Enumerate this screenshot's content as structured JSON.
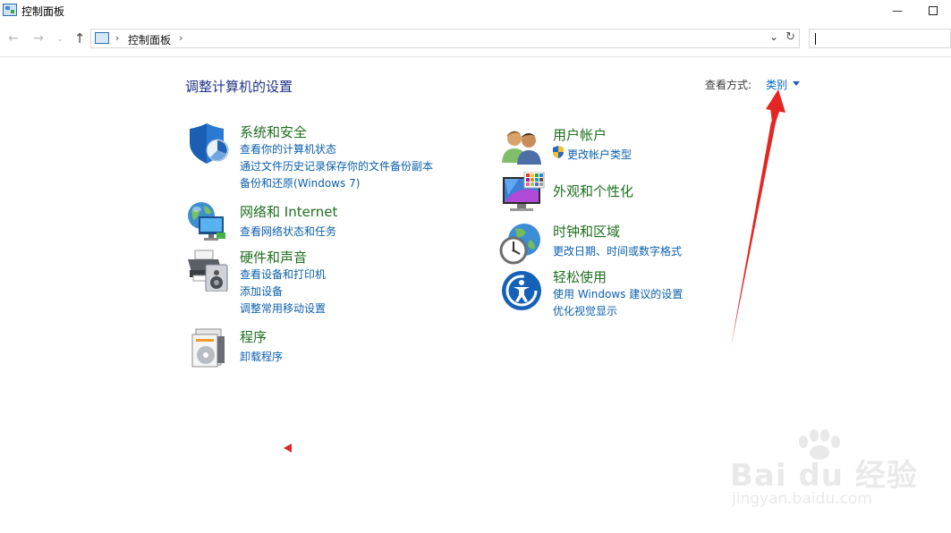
{
  "window": {
    "title": "控制面板",
    "minimize_glyph": "—"
  },
  "navigation": {
    "back_glyph": "←",
    "forward_glyph": "→",
    "recent_glyph": "⌄",
    "up_glyph": "↑",
    "breadcrumb_sep": "›",
    "breadcrumb": "控制面板",
    "dropdown_glyph": "⌄",
    "refresh_glyph": "↻",
    "search_placeholder": ""
  },
  "main": {
    "title": "调整计算机的设置",
    "view_by_label": "查看方式:",
    "view_by_value": "类别"
  },
  "categories_left": [
    {
      "title": "系统和安全",
      "icon": "shield-icon",
      "links": [
        "查看你的计算机状态",
        "通过文件历史记录保存你的文件备份副本",
        "备份和还原(Windows 7)"
      ]
    },
    {
      "title": "网络和 Internet",
      "icon": "network-globe-icon",
      "links": [
        "查看网络状态和任务"
      ]
    },
    {
      "title": "硬件和声音",
      "icon": "printer-speaker-icon",
      "links": [
        "查看设备和打印机",
        "添加设备",
        "调整常用移动设置"
      ]
    },
    {
      "title": "程序",
      "icon": "programs-disc-icon",
      "links": [
        "卸载程序"
      ]
    }
  ],
  "categories_right": [
    {
      "title": "用户帐户",
      "icon": "users-icon",
      "links": [
        "更改帐户类型"
      ]
    },
    {
      "title": "外观和个性化",
      "icon": "monitor-palette-icon",
      "links": []
    },
    {
      "title": "时钟和区域",
      "icon": "clock-globe-icon",
      "links": [
        "更改日期、时间或数字格式"
      ]
    },
    {
      "title": "轻松使用",
      "icon": "ease-of-access-icon",
      "links": [
        "使用 Windows 建议的设置",
        "优化视觉显示"
      ]
    }
  ],
  "watermark": {
    "brand": "Bai du 经验",
    "url": "jingyan.baidu.com"
  },
  "colors": {
    "link": "#0b5fae",
    "category_title": "#1e6e1e",
    "page_title": "#1e3287",
    "annotation_arrow": "#e32622"
  }
}
